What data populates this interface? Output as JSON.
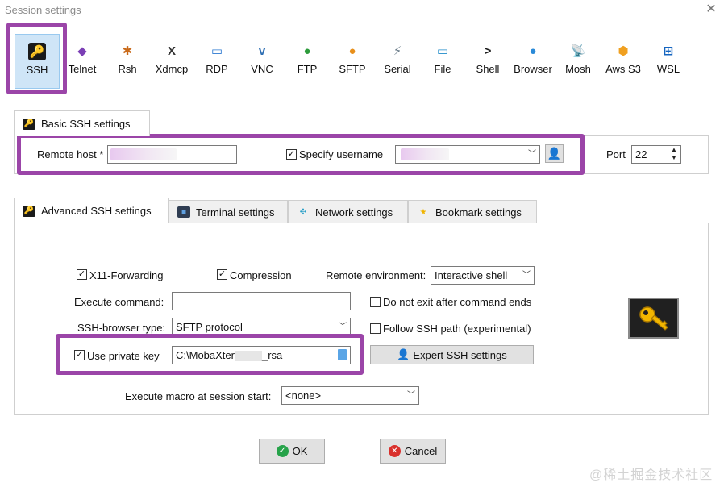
{
  "window": {
    "title": "Session settings",
    "close_symbol": "✕"
  },
  "protocols": [
    {
      "label": "SSH",
      "icon": "ssh-icon",
      "color": "#d69a00",
      "selected": true
    },
    {
      "label": "Telnet",
      "icon": "telnet-icon",
      "color": "#7b3fb5"
    },
    {
      "label": "Rsh",
      "icon": "rsh-icon",
      "color": "#c96a1a"
    },
    {
      "label": "Xdmcp",
      "icon": "xdmcp-icon",
      "color": "#333333"
    },
    {
      "label": "RDP",
      "icon": "rdp-icon",
      "color": "#2b78d0"
    },
    {
      "label": "VNC",
      "icon": "vnc-icon",
      "color": "#2f6fb3"
    },
    {
      "label": "FTP",
      "icon": "ftp-icon",
      "color": "#2d9b3b"
    },
    {
      "label": "SFTP",
      "icon": "sftp-icon",
      "color": "#e88f1a"
    },
    {
      "label": "Serial",
      "icon": "serial-icon",
      "color": "#6b7d8a"
    },
    {
      "label": "File",
      "icon": "file-icon",
      "color": "#1f8bc9"
    },
    {
      "label": "Shell",
      "icon": "shell-icon",
      "color": "#1a1a1a"
    },
    {
      "label": "Browser",
      "icon": "browser-icon",
      "color": "#2a8ad8"
    },
    {
      "label": "Mosh",
      "icon": "mosh-icon",
      "color": "#3a6fc0"
    },
    {
      "label": "Aws S3",
      "icon": "aws-s3-icon",
      "color": "#f0a020"
    },
    {
      "label": "WSL",
      "icon": "wsl-icon",
      "color": "#1565c0"
    }
  ],
  "basic": {
    "tab_label": "Basic SSH settings",
    "remote_host_label": "Remote host *",
    "specify_username_label": "Specify username",
    "specify_username_checked": true,
    "port_label": "Port",
    "port_value": "22"
  },
  "advanced_tabs": [
    {
      "label": "Advanced SSH settings",
      "icon": "ssh-icon",
      "active": true
    },
    {
      "label": "Terminal settings",
      "icon": "terminal-icon"
    },
    {
      "label": "Network settings",
      "icon": "network-icon"
    },
    {
      "label": "Bookmark settings",
      "icon": "star-icon"
    }
  ],
  "advanced": {
    "x11_label": "X11-Forwarding",
    "x11_checked": true,
    "compression_label": "Compression",
    "compression_checked": true,
    "remote_env_label": "Remote environment:",
    "remote_env_value": "Interactive shell",
    "execute_command_label": "Execute command:",
    "execute_command_value": "",
    "do_not_exit_label": "Do not exit after command ends",
    "do_not_exit_checked": false,
    "ssh_browser_label": "SSH-browser type:",
    "ssh_browser_value": "SFTP protocol",
    "follow_ssh_label": "Follow SSH path (experimental)",
    "follow_ssh_checked": false,
    "private_key_label": "Use private key",
    "private_key_checked": true,
    "private_key_prefix": "C:\\MobaXter",
    "private_key_suffix": "_rsa",
    "expert_button_label": "Expert SSH settings",
    "macro_label": "Execute macro at session start:",
    "macro_value": "<none>"
  },
  "buttons": {
    "ok": "OK",
    "cancel": "Cancel"
  },
  "watermark": "@稀土掘金技术社区",
  "colors": {
    "highlight": "#9b45a8",
    "selection": "#cfe5f7"
  }
}
